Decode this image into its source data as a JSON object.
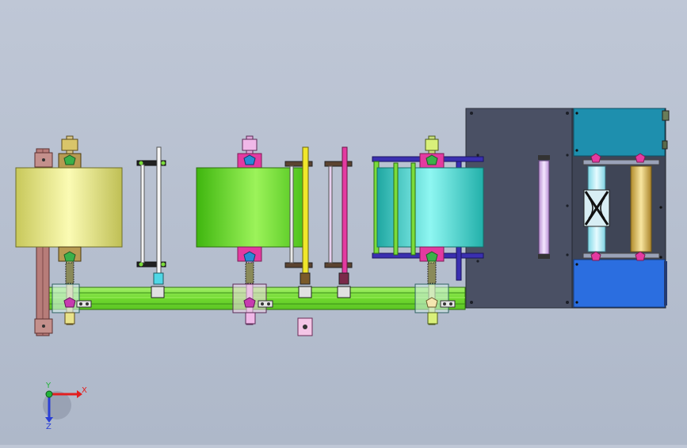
{
  "triad": {
    "x_label": "X",
    "y_label": "Y",
    "z_label": "Z",
    "x_color": "#e21f1f",
    "y_color": "#22b33a",
    "z_color": "#2a3fd6"
  },
  "palette": {
    "background": "#b6bfcf",
    "frame_rail": "#7bdc3a",
    "cover_panel": "#4a5064",
    "roll_1": "#e9ea8a",
    "roll_2": "#6ad61f",
    "roll_3": "#35d4cc",
    "top_box": "#1e8fae",
    "bottom_box": "#2b6ee0",
    "side_roller": "#e9c6f5",
    "pink_rod": "#e43aa0",
    "yellow_rod": "#f0e72a"
  }
}
